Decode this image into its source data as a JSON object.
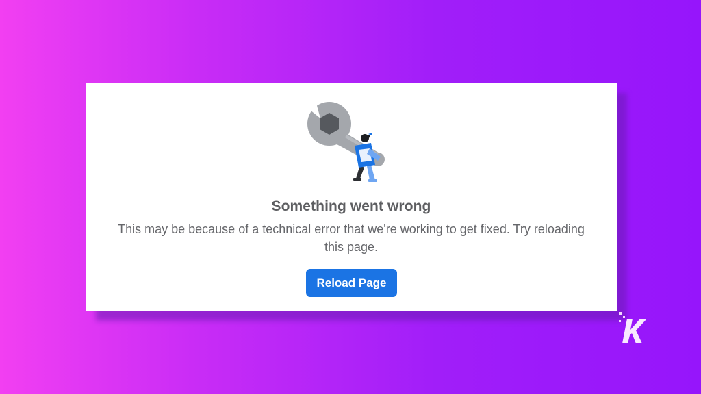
{
  "error": {
    "title": "Something went wrong",
    "message": "This may be because of a technical error that we're working to get fixed. Try reloading this page.",
    "illustration": "wrench-with-worker-icon"
  },
  "actions": {
    "reload_label": "Reload Page"
  },
  "watermark": {
    "text": "K",
    "icon": "knowtechie-logo-icon"
  },
  "colors": {
    "background_left": "#f23ff2",
    "background_right": "#9615fb",
    "button": "#1b74e4",
    "title_text": "#5d5e61",
    "body_text": "#66676b"
  }
}
